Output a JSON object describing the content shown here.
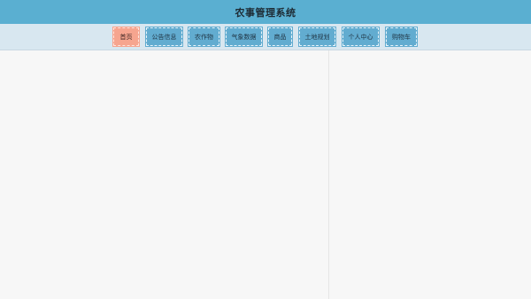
{
  "header": {
    "title": "农事管理系统"
  },
  "nav": {
    "items": [
      {
        "label": "首页",
        "active": true
      },
      {
        "label": "公告信息",
        "active": false
      },
      {
        "label": "农作物",
        "active": false
      },
      {
        "label": "气象数据",
        "active": false
      },
      {
        "label": "商品",
        "active": false
      },
      {
        "label": "土地规划",
        "active": false
      },
      {
        "label": "个人中心",
        "active": false
      },
      {
        "label": "购物车",
        "active": false
      }
    ]
  },
  "colors": {
    "header_bg": "#5aafd1",
    "nav_bg": "#d8e7f0",
    "nav_item_bg": "#62acd0",
    "nav_active_bg": "#f6a58f",
    "page_bg": "#f7f7f7"
  }
}
